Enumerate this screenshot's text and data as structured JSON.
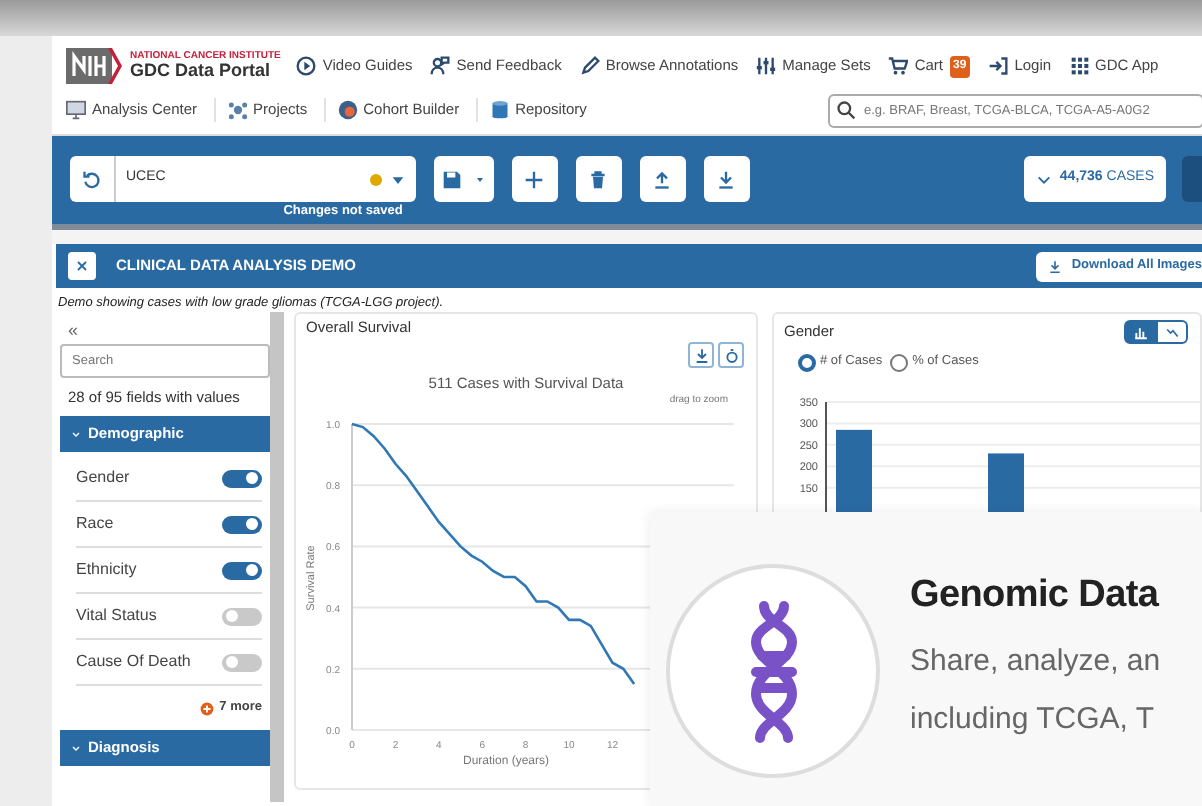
{
  "header": {
    "agency": "NATIONAL CANCER INSTITUTE",
    "portal": "GDC Data Portal",
    "top_links": [
      {
        "label": "Video Guides"
      },
      {
        "label": "Send Feedback"
      },
      {
        "label": "Browse Annotations"
      },
      {
        "label": "Manage Sets"
      },
      {
        "label": "Cart",
        "badge": "39"
      },
      {
        "label": "Login"
      },
      {
        "label": "GDC App"
      }
    ],
    "nav": [
      {
        "label": "Analysis Center"
      },
      {
        "label": "Projects"
      },
      {
        "label": "Cohort Builder"
      },
      {
        "label": "Repository"
      }
    ],
    "search": {
      "placeholder": "e.g. BRAF, Breast, TCGA-BLCA, TCGA-A5-A0G2"
    }
  },
  "cohort_bar": {
    "cohort": "UCEC",
    "unsaved": true,
    "unsaved_note": "Changes not saved",
    "cases": "**44,736** CASES"
  },
  "demo": {
    "title": "CLINICAL DATA ANALYSIS DEMO",
    "download": "Download All Images",
    "description": "Demo showing cases with low grade gliomas (TCGA-LGG project)."
  },
  "sidebar": {
    "collapse": "«",
    "search_placeholder": "Search",
    "summary": "28 of 95 fields with values",
    "groups": [
      {
        "title": "Demographic",
        "expanded": true,
        "fields": [
          {
            "name": "Gender",
            "on": true
          },
          {
            "name": "Race",
            "on": true
          },
          {
            "name": "Ethnicity",
            "on": true
          },
          {
            "name": "Vital Status",
            "on": false
          },
          {
            "name": "Cause Of Death",
            "on": false
          }
        ],
        "more": "7 more"
      },
      {
        "title": "Diagnosis",
        "expanded": true
      }
    ]
  },
  "survival": {
    "title": "Overall Survival",
    "hint": "drag to zoom",
    "chart_data": {
      "type": "line",
      "title": "511 Cases with Survival Data",
      "xlabel": "Duration (years)",
      "ylabel": "Survival Rate",
      "color": "#2f78b5",
      "x": [
        0,
        0.5,
        1,
        1.5,
        2,
        2.5,
        3,
        3.5,
        4,
        4.5,
        5,
        5.5,
        6,
        6.5,
        7,
        7.5,
        8,
        8.5,
        9,
        9.5,
        10,
        10.5,
        11,
        11.5,
        12,
        12.5,
        13
      ],
      "values": [
        1.0,
        0.99,
        0.96,
        0.92,
        0.87,
        0.83,
        0.78,
        0.73,
        0.68,
        0.64,
        0.6,
        0.57,
        0.55,
        0.52,
        0.5,
        0.5,
        0.47,
        0.42,
        0.42,
        0.4,
        0.36,
        0.36,
        0.34,
        0.28,
        0.22,
        0.2,
        0.15
      ],
      "xticks": [
        0,
        2,
        4,
        6,
        8,
        10,
        12
      ],
      "yticks": [
        {
          "value": 0,
          "label": "0.0"
        },
        {
          "value": 0.2,
          "label": "0.2"
        },
        {
          "value": 0.4,
          "label": "0.4"
        },
        {
          "value": 0.6,
          "label": "0.6"
        },
        {
          "value": 0.8,
          "label": "0.8"
        },
        {
          "value": 1,
          "label": "1.0"
        }
      ],
      "xlim": [
        0,
        17.6
      ],
      "ylim": [
        0,
        1
      ],
      "grid": true
    }
  },
  "gender": {
    "title": "Gender",
    "views": [
      {
        "selected": true
      },
      {
        "selected": false
      }
    ],
    "modes": [
      {
        "label": "# of Cases",
        "selected": true
      },
      {
        "label": "% of Cases",
        "selected": false
      }
    ],
    "chart_data": {
      "type": "bar",
      "color": "#2a6aa3",
      "values": [
        285,
        230
      ],
      "yticks": [
        150,
        200,
        250,
        300,
        350
      ],
      "ylim": [
        0,
        350
      ],
      "grid": true
    }
  },
  "promo": {
    "title": "Genomic Data",
    "lines": [
      "Share, analyze, an",
      "including TCGA, T"
    ]
  }
}
